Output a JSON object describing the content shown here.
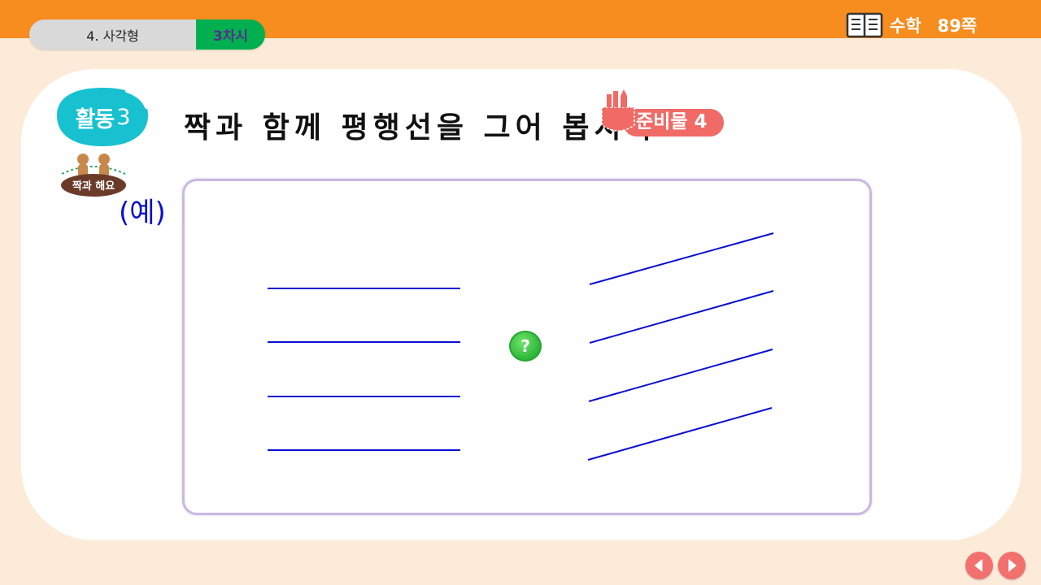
{
  "header": {
    "unit": "4. 사각형",
    "lesson": "3차시",
    "subject": "수학",
    "page": "89쪽",
    "book_icon": "open-book-icon"
  },
  "activity": {
    "badge_label": "활동",
    "badge_number": "3",
    "pair_label": "짝과 해요",
    "title": "짝과 함께 평행선을 그어 봅시다",
    "prep_label": "준비물 4",
    "example_label": "(예)"
  },
  "board": {
    "help_label": "?"
  },
  "colors": {
    "topbar": "#f78c1f",
    "background": "#fdebd9",
    "lesson": "#00b050",
    "line": "#0a10d0",
    "badge": "#17c1cf",
    "prep": "#f06a66"
  },
  "nav": {
    "prev_icon": "prev-arrow-icon",
    "next_icon": "next-arrow-icon"
  }
}
